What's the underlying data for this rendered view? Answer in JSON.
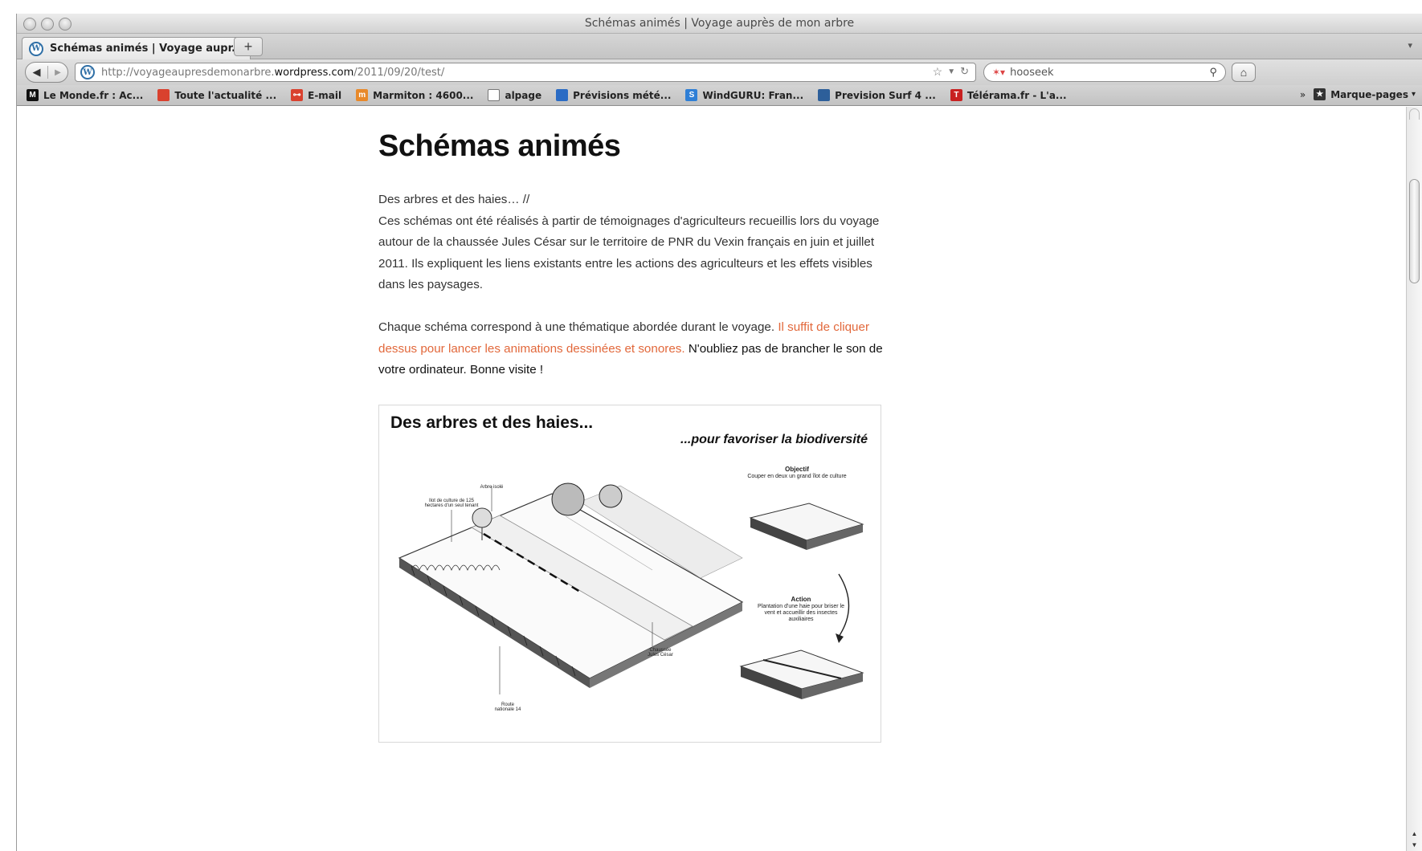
{
  "window": {
    "title": "Schémas animés | Voyage auprès de mon arbre"
  },
  "tab": {
    "label": "Schémas animés | Voyage aupr...",
    "new_tab_symbol": "+"
  },
  "nav": {
    "url_prefix": "http://voyageaupresdemonarbre.",
    "url_domain": "wordpress.com",
    "url_path": "/2011/09/20/test/",
    "search_text": "hooseek"
  },
  "bookmarks": [
    {
      "label": "Le Monde.fr : Ac...",
      "icon": "lemonde-icon",
      "color": "#111111",
      "glyph": "M"
    },
    {
      "label": "Toute l'actualité ...",
      "icon": "news-icon",
      "color": "#d9412e",
      "glyph": ""
    },
    {
      "label": "E-mail",
      "icon": "key-icon",
      "color": "#d9412e",
      "glyph": "⊶"
    },
    {
      "label": "Marmiton : 4600...",
      "icon": "marmiton-icon",
      "color": "#e8892a",
      "glyph": "m"
    },
    {
      "label": "alpage",
      "icon": "page-icon",
      "color": "#ffffff",
      "glyph": ""
    },
    {
      "label": "Prévisions mété...",
      "icon": "weather-icon",
      "color": "#2a6bc4",
      "glyph": ""
    },
    {
      "label": "WindGURU: Fran...",
      "icon": "windguru-icon",
      "color": "#2f7fd6",
      "glyph": "S"
    },
    {
      "label": "Prevision Surf 4 ...",
      "icon": "surf-icon",
      "color": "#2d5f9a",
      "glyph": ""
    },
    {
      "label": "Télérama.fr - L'a...",
      "icon": "telerama-icon",
      "color": "#c82020",
      "glyph": "T"
    }
  ],
  "bookmarks_menu": {
    "chevron": "»",
    "label": "Marque-pages"
  },
  "post": {
    "title": "Schémas animés",
    "p1_line1": "Des arbres et des haies… //",
    "p1_rest": "Ces schémas ont été réalisés à partir de témoignages d'agriculteurs recueillis lors du voyage autour de la chaussée Jules César sur le territoire de PNR du Vexin français en juin et juillet 2011. Ils expliquent les liens existants entre les actions des agriculteurs et les effets visibles dans les paysages.",
    "p2_start": "Chaque schéma correspond à une thématique abordée durant le voyage.",
    "p2_link": "Il suffit de cliquer dessus pour lancer les animations dessinées et sonores.",
    "p2_end": "N'oubliez pas de brancher le son de votre ordinateur. Bonne visite !"
  },
  "figure": {
    "title": "Des arbres et des haies...",
    "subtitle": "...pour favoriser la biodiversité",
    "objectif_title": "Objectif",
    "objectif_text": "Couper en deux un grand îlot de culture",
    "action_title": "Action",
    "action_text": "Plantation d'une haie pour briser le vent et accueillir des insectes auxiliaires",
    "label_ilot": "Ilot de culture de 125 hectares d'un seul tenant",
    "label_arbre": "Arbre isolé",
    "label_chaussee": "Chaussée Jules César",
    "label_route": "Route nationale 14"
  },
  "colors": {
    "link": "#e2683b",
    "text": "#333333",
    "title": "#111111"
  }
}
